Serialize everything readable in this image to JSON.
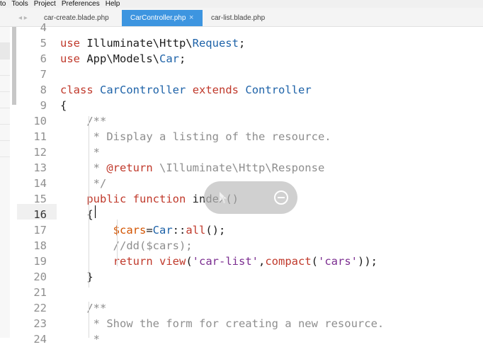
{
  "menu": [
    "to",
    "Tools",
    "Project",
    "Preferences",
    "Help"
  ],
  "tabs": [
    {
      "label": "car-create.blade.php",
      "active": false
    },
    {
      "label": "CarController.php",
      "active": true,
      "close": "×"
    },
    {
      "label": "car-list.blade.php",
      "active": false
    }
  ],
  "tab_nav_icon": "arrow-nav-icon",
  "tab_nav_glyph": "◂ ▸",
  "editor": {
    "current_line": "16",
    "lines": [
      {
        "n": "4",
        "tokens": []
      },
      {
        "n": "5",
        "tokens": [
          [
            "kw",
            "use"
          ],
          [
            "t",
            " Illuminate\\Http\\"
          ],
          [
            "cls",
            "Request"
          ],
          [
            "t",
            ";"
          ]
        ]
      },
      {
        "n": "6",
        "tokens": [
          [
            "kw",
            "use"
          ],
          [
            "t",
            " App\\Models\\"
          ],
          [
            "cls",
            "Car"
          ],
          [
            "t",
            ";"
          ]
        ]
      },
      {
        "n": "7",
        "tokens": []
      },
      {
        "n": "8",
        "tokens": [
          [
            "kw",
            "class"
          ],
          [
            "t",
            " "
          ],
          [
            "cls",
            "CarController"
          ],
          [
            "t",
            " "
          ],
          [
            "kw",
            "extends"
          ],
          [
            "t",
            " "
          ],
          [
            "cls",
            "Controller"
          ]
        ]
      },
      {
        "n": "9",
        "tokens": [
          [
            "t",
            "{"
          ]
        ]
      },
      {
        "n": "10",
        "tokens": [
          [
            "t",
            "    "
          ],
          [
            "cm",
            "/**"
          ]
        ]
      },
      {
        "n": "11",
        "tokens": [
          [
            "t",
            "    "
          ],
          [
            "cm",
            " * Display a listing of the resource."
          ]
        ]
      },
      {
        "n": "12",
        "tokens": [
          [
            "t",
            "    "
          ],
          [
            "cm",
            " *"
          ]
        ]
      },
      {
        "n": "13",
        "tokens": [
          [
            "t",
            "    "
          ],
          [
            "cm",
            " * "
          ],
          [
            "tag",
            "@return"
          ],
          [
            "cm",
            " \\Illuminate\\Http\\Response"
          ]
        ]
      },
      {
        "n": "14",
        "tokens": [
          [
            "t",
            "    "
          ],
          [
            "cm",
            " */"
          ]
        ]
      },
      {
        "n": "15",
        "tokens": [
          [
            "t",
            "    "
          ],
          [
            "kw",
            "public"
          ],
          [
            "t",
            " "
          ],
          [
            "kw",
            "function"
          ],
          [
            "t",
            " index()"
          ]
        ]
      },
      {
        "n": "16",
        "tokens": [
          [
            "t",
            "    {"
          ]
        ]
      },
      {
        "n": "17",
        "tokens": [
          [
            "t",
            "        "
          ],
          [
            "var",
            "$cars"
          ],
          [
            "t",
            "="
          ],
          [
            "cls",
            "Car"
          ],
          [
            "t",
            "::"
          ],
          [
            "fn",
            "all"
          ],
          [
            "t",
            "();"
          ]
        ]
      },
      {
        "n": "18",
        "tokens": [
          [
            "t",
            "        "
          ],
          [
            "cm",
            "//dd($cars);"
          ]
        ]
      },
      {
        "n": "19",
        "tokens": [
          [
            "t",
            "        "
          ],
          [
            "kw",
            "return"
          ],
          [
            "t",
            " "
          ],
          [
            "fn",
            "view"
          ],
          [
            "t",
            "("
          ],
          [
            "str",
            "'car-list'"
          ],
          [
            "t",
            ","
          ],
          [
            "fn",
            "compact"
          ],
          [
            "t",
            "("
          ],
          [
            "str",
            "'cars'"
          ],
          [
            "t",
            "));"
          ]
        ]
      },
      {
        "n": "20",
        "tokens": [
          [
            "t",
            "    }"
          ]
        ]
      },
      {
        "n": "21",
        "tokens": []
      },
      {
        "n": "22",
        "tokens": [
          [
            "t",
            "    "
          ],
          [
            "cm",
            "/**"
          ]
        ]
      },
      {
        "n": "23",
        "tokens": [
          [
            "t",
            "    "
          ],
          [
            "cm",
            " * Show the form for creating a new resource."
          ]
        ]
      },
      {
        "n": "24",
        "tokens": [
          [
            "t",
            "    "
          ],
          [
            "cm",
            " *"
          ]
        ]
      }
    ]
  },
  "overlay": {
    "left_icon": "cursor-pointer-icon",
    "right_icon": "minus-circle-icon"
  }
}
